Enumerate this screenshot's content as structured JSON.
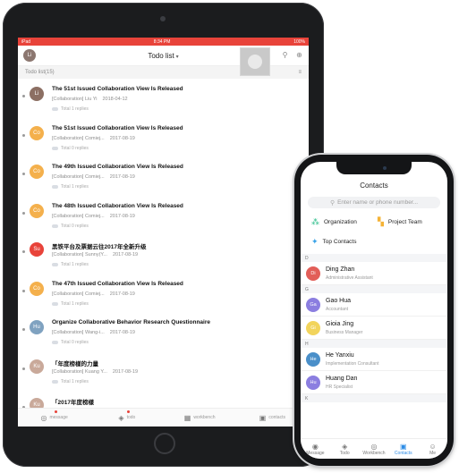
{
  "tablet": {
    "status": {
      "left": "iPad",
      "time": "8:34 PM",
      "battery": "100%"
    },
    "nav": {
      "avatar": "Li",
      "title": "Todo list",
      "chevron": "▾"
    },
    "subheader": {
      "label": "Todo list(15)",
      "icon": "≡"
    },
    "items": [
      {
        "avatar": "Li",
        "avatar_color": "#8c6f63",
        "title": "The 51st Issued Collaboration View Is Released",
        "source": "[Collaboration] Liu Yi",
        "date": "2018-04-12",
        "replies": "Total 1 replies"
      },
      {
        "avatar": "Co",
        "avatar_color": "#f4b04c",
        "title": "The 51st Issued Collaboration View Is Released",
        "source": "[Collaboration] Comiej...",
        "date": "2017-08-19",
        "replies": "Total 0 replies"
      },
      {
        "avatar": "Co",
        "avatar_color": "#f4b04c",
        "title": "The 49th Issued Collaboration View Is Released",
        "source": "[Collaboration] Comiej...",
        "date": "2017-08-19",
        "replies": "Total 1 replies"
      },
      {
        "avatar": "Co",
        "avatar_color": "#f4b04c",
        "title": "The 48th Issued Collaboration View Is Released",
        "source": "[Collaboration] Comiej...",
        "date": "2017-08-19",
        "replies": "Total 0 replies"
      },
      {
        "avatar": "Su",
        "avatar_color": "#e8433a",
        "title": "黑铁平台及票据云往2017年全新升级",
        "source": "[Collaboration] Sunny(Y...",
        "date": "2017-08-19",
        "replies": "Total 1 replies"
      },
      {
        "avatar": "Co",
        "avatar_color": "#f4b04c",
        "title": "The 47th Issued Collaboration View Is Released",
        "source": "[Collaboration] Comiej...",
        "date": "2017-08-19",
        "replies": "Total 1 replies"
      },
      {
        "avatar": "Hu",
        "avatar_color": "#7fa2c0",
        "title": "Organize Collaborative Behavior Research Questionnaire",
        "source": "[Collaboration] Wang-i...",
        "date": "2017-08-19",
        "replies": "Total 0 replies"
      },
      {
        "avatar": "Ku",
        "avatar_color": "#c9a99a",
        "title": "「年度榜樣的力量",
        "source": "[Collaboration] Kuang Y...",
        "date": "2017-08-19",
        "replies": "Total 1 replies"
      },
      {
        "avatar": "Ku",
        "avatar_color": "#c9a99a",
        "title": "「2017年度榜樣",
        "source": "",
        "date": "",
        "replies": ""
      }
    ],
    "tabs": [
      {
        "icon": "◎",
        "label": "message",
        "badge": true
      },
      {
        "icon": "◈",
        "label": "todo",
        "badge": true
      },
      {
        "icon": "▦",
        "label": "workbench",
        "badge": false
      },
      {
        "icon": "▣",
        "label": "contacts",
        "badge": false
      }
    ]
  },
  "phone": {
    "title": "Contacts",
    "search_placeholder": "Enter name or phone number...",
    "quick": [
      {
        "icon": "⁂",
        "label": "Organization",
        "color": "#2fbf8c"
      },
      {
        "icon": "▚",
        "label": "Project Team",
        "color": "#f5b336"
      },
      {
        "icon": "✦",
        "label": "Top Contacts",
        "color": "#3aa3e8"
      }
    ],
    "sections": [
      "D",
      "G",
      "H",
      "K"
    ],
    "contacts": [
      {
        "avatar": "Di",
        "avatar_color": "#e25e58",
        "name": "Ding Zhan",
        "role": "Administrative Assistant"
      },
      {
        "avatar": "Ga",
        "avatar_color": "#8b7ee0",
        "name": "Gao Hua",
        "role": "Accountant"
      },
      {
        "avatar": "Gi",
        "avatar_color": "#f2d45c",
        "name": "Gioia Jing",
        "role": "Business Manager"
      },
      {
        "avatar": "He",
        "avatar_color": "#4a8fc9",
        "name": "He Yanxiu",
        "role": "Implementation Consultant"
      },
      {
        "avatar": "Hu",
        "avatar_color": "#8b7ee0",
        "name": "Huang Dan",
        "role": "HR Specialist"
      }
    ],
    "tabs": [
      {
        "icon": "◉",
        "label": "Message",
        "active": false
      },
      {
        "icon": "◈",
        "label": "Todo",
        "active": false
      },
      {
        "icon": "◎",
        "label": "Workbench",
        "active": false
      },
      {
        "icon": "▣",
        "label": "Contacts",
        "active": true
      },
      {
        "icon": "☺",
        "label": "Me",
        "active": false
      }
    ]
  }
}
